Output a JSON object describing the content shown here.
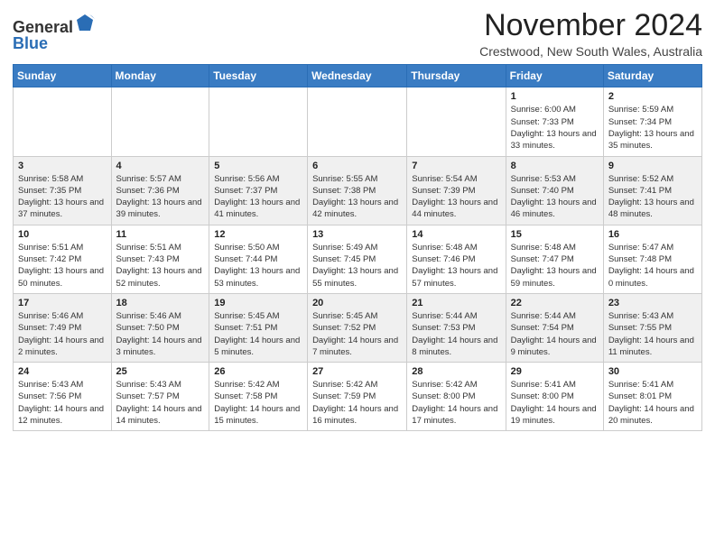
{
  "header": {
    "logo_general": "General",
    "logo_blue": "Blue",
    "month_title": "November 2024",
    "subtitle": "Crestwood, New South Wales, Australia"
  },
  "weekdays": [
    "Sunday",
    "Monday",
    "Tuesday",
    "Wednesday",
    "Thursday",
    "Friday",
    "Saturday"
  ],
  "weeks": [
    [
      {
        "day": "",
        "info": ""
      },
      {
        "day": "",
        "info": ""
      },
      {
        "day": "",
        "info": ""
      },
      {
        "day": "",
        "info": ""
      },
      {
        "day": "",
        "info": ""
      },
      {
        "day": "1",
        "info": "Sunrise: 6:00 AM\nSunset: 7:33 PM\nDaylight: 13 hours and 33 minutes."
      },
      {
        "day": "2",
        "info": "Sunrise: 5:59 AM\nSunset: 7:34 PM\nDaylight: 13 hours and 35 minutes."
      }
    ],
    [
      {
        "day": "3",
        "info": "Sunrise: 5:58 AM\nSunset: 7:35 PM\nDaylight: 13 hours and 37 minutes."
      },
      {
        "day": "4",
        "info": "Sunrise: 5:57 AM\nSunset: 7:36 PM\nDaylight: 13 hours and 39 minutes."
      },
      {
        "day": "5",
        "info": "Sunrise: 5:56 AM\nSunset: 7:37 PM\nDaylight: 13 hours and 41 minutes."
      },
      {
        "day": "6",
        "info": "Sunrise: 5:55 AM\nSunset: 7:38 PM\nDaylight: 13 hours and 42 minutes."
      },
      {
        "day": "7",
        "info": "Sunrise: 5:54 AM\nSunset: 7:39 PM\nDaylight: 13 hours and 44 minutes."
      },
      {
        "day": "8",
        "info": "Sunrise: 5:53 AM\nSunset: 7:40 PM\nDaylight: 13 hours and 46 minutes."
      },
      {
        "day": "9",
        "info": "Sunrise: 5:52 AM\nSunset: 7:41 PM\nDaylight: 13 hours and 48 minutes."
      }
    ],
    [
      {
        "day": "10",
        "info": "Sunrise: 5:51 AM\nSunset: 7:42 PM\nDaylight: 13 hours and 50 minutes."
      },
      {
        "day": "11",
        "info": "Sunrise: 5:51 AM\nSunset: 7:43 PM\nDaylight: 13 hours and 52 minutes."
      },
      {
        "day": "12",
        "info": "Sunrise: 5:50 AM\nSunset: 7:44 PM\nDaylight: 13 hours and 53 minutes."
      },
      {
        "day": "13",
        "info": "Sunrise: 5:49 AM\nSunset: 7:45 PM\nDaylight: 13 hours and 55 minutes."
      },
      {
        "day": "14",
        "info": "Sunrise: 5:48 AM\nSunset: 7:46 PM\nDaylight: 13 hours and 57 minutes."
      },
      {
        "day": "15",
        "info": "Sunrise: 5:48 AM\nSunset: 7:47 PM\nDaylight: 13 hours and 59 minutes."
      },
      {
        "day": "16",
        "info": "Sunrise: 5:47 AM\nSunset: 7:48 PM\nDaylight: 14 hours and 0 minutes."
      }
    ],
    [
      {
        "day": "17",
        "info": "Sunrise: 5:46 AM\nSunset: 7:49 PM\nDaylight: 14 hours and 2 minutes."
      },
      {
        "day": "18",
        "info": "Sunrise: 5:46 AM\nSunset: 7:50 PM\nDaylight: 14 hours and 3 minutes."
      },
      {
        "day": "19",
        "info": "Sunrise: 5:45 AM\nSunset: 7:51 PM\nDaylight: 14 hours and 5 minutes."
      },
      {
        "day": "20",
        "info": "Sunrise: 5:45 AM\nSunset: 7:52 PM\nDaylight: 14 hours and 7 minutes."
      },
      {
        "day": "21",
        "info": "Sunrise: 5:44 AM\nSunset: 7:53 PM\nDaylight: 14 hours and 8 minutes."
      },
      {
        "day": "22",
        "info": "Sunrise: 5:44 AM\nSunset: 7:54 PM\nDaylight: 14 hours and 9 minutes."
      },
      {
        "day": "23",
        "info": "Sunrise: 5:43 AM\nSunset: 7:55 PM\nDaylight: 14 hours and 11 minutes."
      }
    ],
    [
      {
        "day": "24",
        "info": "Sunrise: 5:43 AM\nSunset: 7:56 PM\nDaylight: 14 hours and 12 minutes."
      },
      {
        "day": "25",
        "info": "Sunrise: 5:43 AM\nSunset: 7:57 PM\nDaylight: 14 hours and 14 minutes."
      },
      {
        "day": "26",
        "info": "Sunrise: 5:42 AM\nSunset: 7:58 PM\nDaylight: 14 hours and 15 minutes."
      },
      {
        "day": "27",
        "info": "Sunrise: 5:42 AM\nSunset: 7:59 PM\nDaylight: 14 hours and 16 minutes."
      },
      {
        "day": "28",
        "info": "Sunrise: 5:42 AM\nSunset: 8:00 PM\nDaylight: 14 hours and 17 minutes."
      },
      {
        "day": "29",
        "info": "Sunrise: 5:41 AM\nSunset: 8:00 PM\nDaylight: 14 hours and 19 minutes."
      },
      {
        "day": "30",
        "info": "Sunrise: 5:41 AM\nSunset: 8:01 PM\nDaylight: 14 hours and 20 minutes."
      }
    ]
  ]
}
